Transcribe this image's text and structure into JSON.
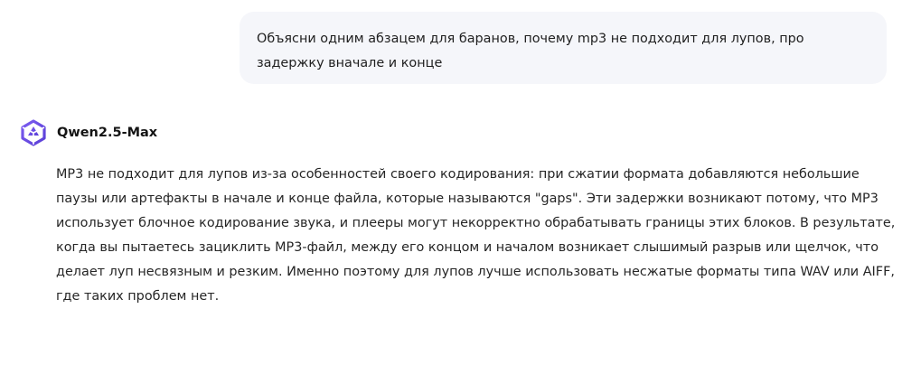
{
  "conversation": {
    "user_message": "Объясни одним абзацем для баранов, почему mp3 не подходит для лупов, про задержку вначале и конце",
    "assistant": {
      "model_name": "Qwen2.5-Max",
      "avatar_icon": "qwen-logo-icon",
      "avatar_color": "#6b4fe0",
      "response": "MP3 не подходит для лупов из-за особенностей своего кодирования: при сжатии формата добавляются небольшие паузы или артефакты в начале и конце файла, которые называются \"gaps\". Эти задержки возникают потому, что MP3 использует блочное кодирование звука, и плееры могут некорректно обрабатывать границы этих блоков. В результате, когда вы пытаетесь зациклить MP3-файл, между его концом и началом возникает слышимый разрыв или щелчок, что делает луп несвязным и резким. Именно поэтому для лупов лучше использовать несжатые форматы типа WAV или AIFF, где таких проблем нет."
    }
  }
}
